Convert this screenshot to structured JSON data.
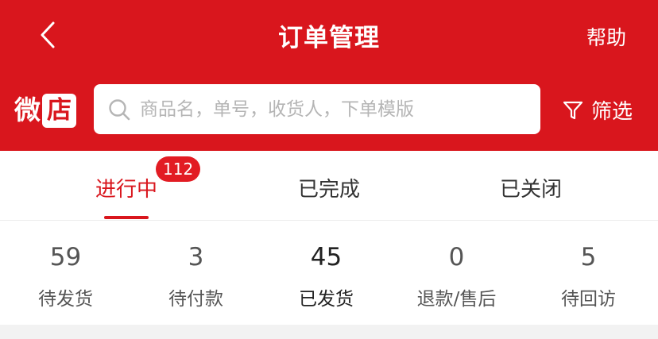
{
  "header": {
    "title": "订单管理",
    "help_label": "帮助",
    "back_icon": "chevron-left-icon"
  },
  "brand": {
    "logo_text": "微",
    "logo_box_text": "店"
  },
  "search": {
    "placeholder": "商品名，单号，收货人，下单模版",
    "value": "",
    "icon": "search-icon"
  },
  "filter": {
    "label": "筛选",
    "icon": "filter-icon"
  },
  "tabs": [
    {
      "label": "进行中",
      "badge": "112",
      "active": true
    },
    {
      "label": "已完成",
      "active": false
    },
    {
      "label": "已关闭",
      "active": false
    }
  ],
  "stats": [
    {
      "count": "59",
      "label": "待发货"
    },
    {
      "count": "3",
      "label": "待付款"
    },
    {
      "count": "45",
      "label": "已发货",
      "active": true
    },
    {
      "count": "0",
      "label": "退款/售后"
    },
    {
      "count": "5",
      "label": "待回访"
    }
  ],
  "colors": {
    "brand_red": "#d9161d",
    "badge_red": "#e21c23",
    "text_dark": "#222222",
    "text_muted": "#555555"
  }
}
